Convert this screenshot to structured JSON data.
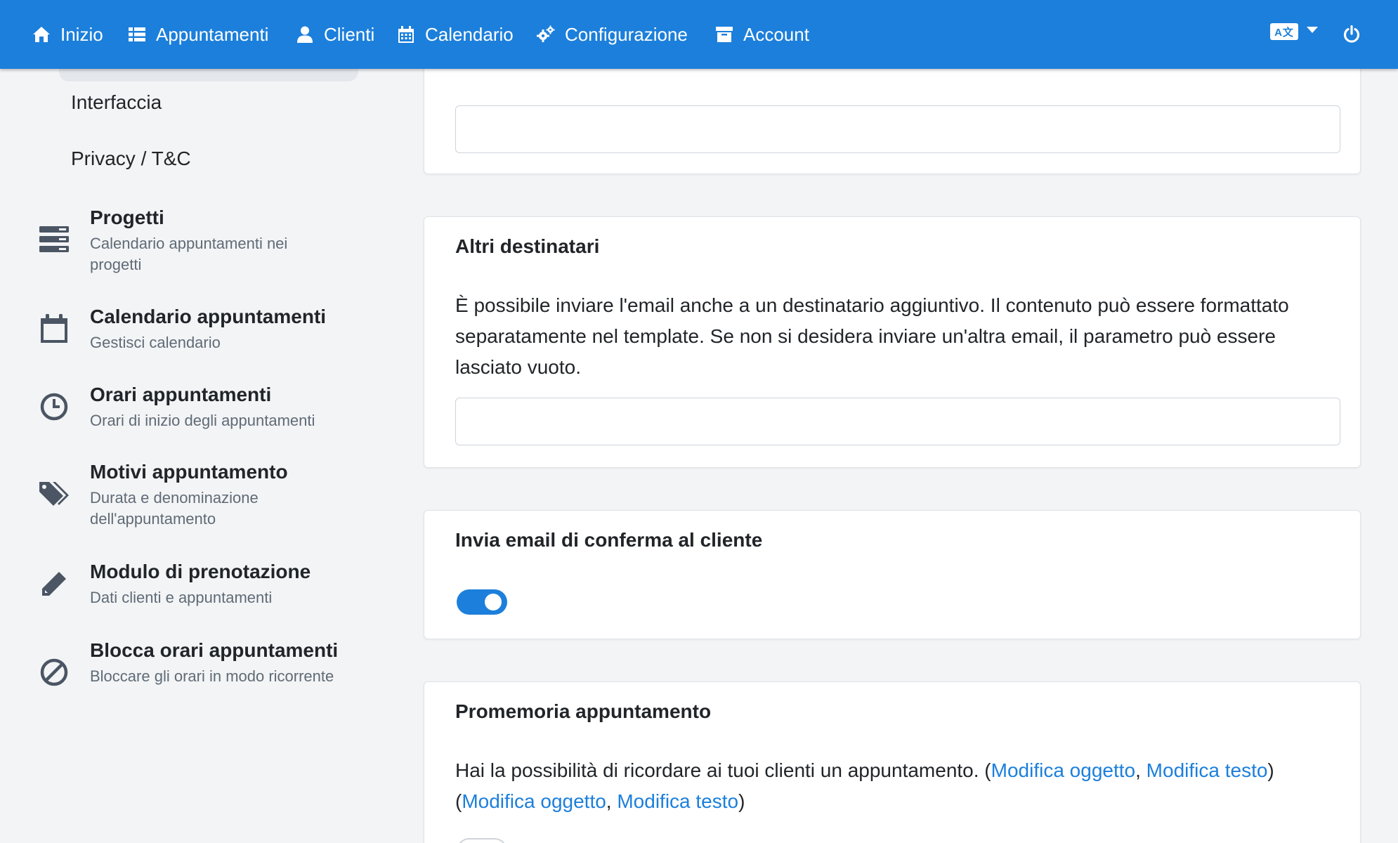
{
  "navbar": {
    "items": [
      {
        "label": "Inizio",
        "icon": "home-icon"
      },
      {
        "label": "Appuntamenti",
        "icon": "list-icon"
      },
      {
        "label": "Clienti",
        "icon": "user-icon"
      },
      {
        "label": "Calendario",
        "icon": "calendar-icon"
      },
      {
        "label": "Configurazione",
        "icon": "gears-icon"
      },
      {
        "label": "Account",
        "icon": "archive-icon"
      }
    ],
    "language_icon": "translate-icon",
    "language_box_text": "A文",
    "power_icon": "power-icon",
    "color": "#1c7fdb"
  },
  "sidebar": {
    "sub_links": [
      "Interfaccia",
      "Privacy / T&C"
    ],
    "items": [
      {
        "title": "Progetti",
        "subtitle": "Calendario appuntamenti nei progetti",
        "icon": "server-icon"
      },
      {
        "title": "Calendario appuntamenti",
        "subtitle": "Gestisci calendario",
        "icon": "calendar-outline-icon"
      },
      {
        "title": "Orari appuntamenti",
        "subtitle": "Orari di inizio degli appuntamenti",
        "icon": "clock-icon"
      },
      {
        "title": "Motivi appuntamento",
        "subtitle": "Durata e denominazione dell'appuntamento",
        "icon": "tags-icon"
      },
      {
        "title": "Modulo di prenotazione",
        "subtitle": "Dati clienti e appuntamenti",
        "icon": "pencil-icon"
      },
      {
        "title": "Blocca orari appuntamenti",
        "subtitle": "Bloccare gli orari in modo ricorrente",
        "icon": "ban-icon"
      }
    ]
  },
  "main": {
    "card_top": {
      "input_value": ""
    },
    "altri_destinatari": {
      "title": "Altri destinatari",
      "description": "È possibile inviare l'email anche a un destinatario aggiuntivo. Il contenuto può essere formattato separatamente nel template. Se non si desidera inviare un'altra email, il parametro può essere lasciato vuoto.",
      "input_value": ""
    },
    "conferma": {
      "title": "Invia email di conferma al cliente",
      "toggle_on": true
    },
    "promemoria": {
      "title": "Promemoria appuntamento",
      "text": "Hai la possibilità di ricordare ai tuoi clienti un appuntamento.",
      "link_oggetto": "Modifica oggetto",
      "link_testo": "Modifica testo",
      "toggle_on": false
    }
  }
}
